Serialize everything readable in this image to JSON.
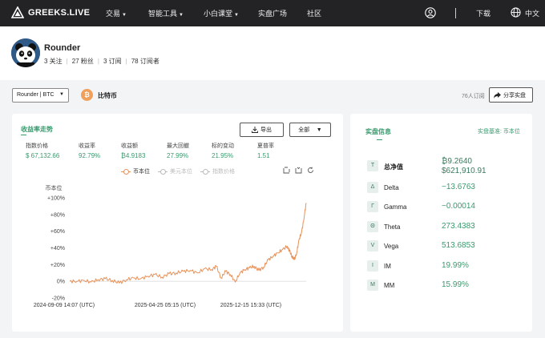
{
  "nav": {
    "brand": "GREEKS.LIVE",
    "items": [
      {
        "label": "交易",
        "caret": true
      },
      {
        "label": "智能工具",
        "caret": true
      },
      {
        "label": "小白课堂",
        "caret": true
      },
      {
        "label": "实盘广场",
        "caret": false
      },
      {
        "label": "社区",
        "caret": false
      }
    ],
    "download": "下载",
    "language": "中文"
  },
  "profile": {
    "name": "Rounder",
    "following": "3 关注",
    "fans": "27 粉丝",
    "subscriptions": "3 订阅",
    "subscribers": "78 订阅者"
  },
  "toolbar": {
    "strategy_select": "Rounder | BTC",
    "coin_symbol": "₿",
    "coin_name": "比特币",
    "subs_count": "76人订阅",
    "share_label": "分享实盘"
  },
  "returns_card": {
    "title": "收益率走势",
    "export_label": "导出",
    "range_label": "全部",
    "metrics": [
      {
        "label": "指数价格",
        "value": "$ 67,132.66"
      },
      {
        "label": "收益率",
        "value": "92.79%"
      },
      {
        "label": "收益额",
        "value": "₿4.9183"
      },
      {
        "label": "最大回撤",
        "value": "27.99%"
      },
      {
        "label": "标的变动",
        "value": "21.95%"
      },
      {
        "label": "夏普率",
        "value": "1.51"
      }
    ],
    "legend": [
      {
        "label": "币本位",
        "active": true
      },
      {
        "label": "美元本位",
        "active": false
      },
      {
        "label": "指数价格",
        "active": false
      }
    ]
  },
  "chart_data": {
    "type": "line",
    "ylabel": "币本位",
    "ylim": [
      -20,
      100
    ],
    "yticks": [
      "+100%",
      "+80%",
      "+60%",
      "+40%",
      "+20%",
      "0%",
      "-20%"
    ],
    "xticks": [
      "2024-09-09 14:07 (UTC)",
      "2025-04-25 05:15 (UTC)",
      "2025-12-15 15:33 (UTC)"
    ],
    "series": [
      {
        "name": "币本位",
        "color": "#e8925a",
        "x": [
          0,
          3,
          6,
          9,
          12,
          15,
          18,
          21,
          24,
          27,
          30,
          33,
          36,
          39,
          42,
          45,
          48,
          51,
          54,
          57,
          60,
          62,
          64,
          66,
          68,
          70,
          72,
          74,
          76,
          78,
          80,
          82,
          84,
          86,
          88,
          90,
          92,
          93,
          94,
          95,
          96,
          97,
          98,
          99,
          100
        ],
        "y": [
          0,
          0,
          1,
          -1,
          2,
          3,
          1,
          -2,
          2,
          4,
          3,
          6,
          8,
          5,
          9,
          10,
          12,
          13,
          10,
          15,
          14,
          18,
          4,
          12,
          8,
          -1,
          10,
          14,
          16,
          18,
          13,
          17,
          26,
          30,
          34,
          38,
          42,
          36,
          30,
          26,
          34,
          50,
          58,
          74,
          94
        ]
      }
    ]
  },
  "greeks_card": {
    "title": "实盘信息",
    "basis": "实盘基准: 币本位",
    "rows": [
      {
        "icon": "T",
        "label": "总净值",
        "value": "₿9.2640",
        "value2": "$621,910.91"
      },
      {
        "icon": "Δ",
        "label": "Delta",
        "value": "−13.6763"
      },
      {
        "icon": "Γ",
        "label": "Gamma",
        "value": "−0.00014"
      },
      {
        "icon": "Θ",
        "label": "Theta",
        "value": "273.4383"
      },
      {
        "icon": "V",
        "label": "Vega",
        "value": "513.6853"
      },
      {
        "icon": "I",
        "label": "IM",
        "value": "19.99%"
      },
      {
        "icon": "M",
        "label": "MM",
        "value": "15.99%"
      }
    ]
  }
}
